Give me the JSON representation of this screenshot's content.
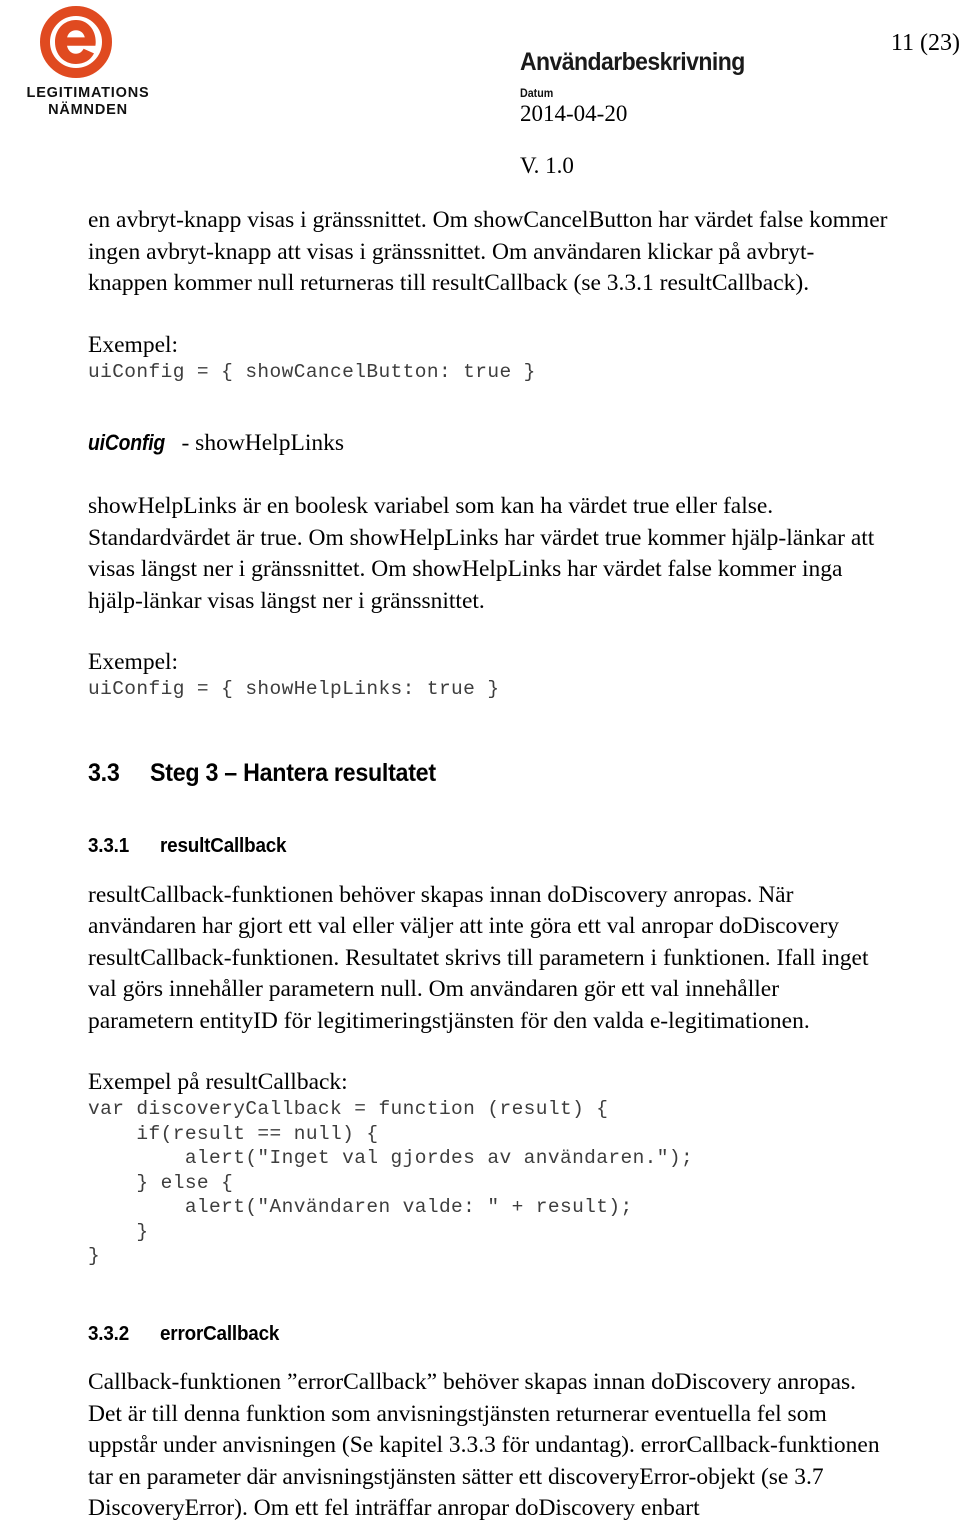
{
  "header": {
    "logo": {
      "icon": "e-circle-logo",
      "color": "#E04A20",
      "wordmark_line1": "LEGITIMATIONS",
      "wordmark_line2": "NÄMNDEN"
    },
    "document_title": "Användarbeskrivning",
    "date_label": "Datum",
    "date_value": "2014-04-20",
    "version": "V. 1.0",
    "page_number": "11 (23)"
  },
  "body": {
    "intro_paragraph": "en avbryt-knapp visas i gränssnittet. Om showCancelButton har värdet false kommer ingen avbryt-knapp att visas i gränssnittet. Om användaren klickar på avbryt-knappen kommer null returneras till resultCallback (se 3.3.1 resultCallback).",
    "exempel_label_1": "Exempel:",
    "code_1": "uiConfig = { showCancelButton: true }",
    "subsection_showhelplinks": {
      "keyword": "uiConfig",
      "rest": " - showHelpLinks"
    },
    "showhelplinks_paragraph": "showHelpLinks är en boolesk variabel som kan ha värdet true eller false. Standardvärdet är true. Om showHelpLinks har värdet true kommer hjälp-länkar att visas längst ner i gränssnittet. Om showHelpLinks har värdet false kommer inga hjälp-länkar visas längst ner i gränssnittet.",
    "exempel_label_2": "Exempel:",
    "code_2": "uiConfig = { showHelpLinks: true }",
    "heading_3_3": {
      "number": "3.3",
      "text": "Steg 3 – Hantera resultatet"
    },
    "heading_3_3_1": {
      "number": "3.3.1",
      "text": "resultCallback"
    },
    "resultcallback_paragraph": "resultCallback-funktionen behöver skapas innan doDiscovery anropas. När användaren har gjort ett val eller väljer att inte göra ett val anropar doDiscovery resultCallback-funktionen. Resultatet skrivs till parametern i funktionen. Ifall inget val görs innehåller parametern null. Om användaren gör ett val innehåller parametern entityID för legitimeringstjänsten för den valda e-legitimationen.",
    "exempel_label_3": "Exempel på resultCallback:",
    "code_3": "var discoveryCallback = function (result) {\n    if(result == null) {\n        alert(\"Inget val gjordes av användaren.\");\n    } else {\n        alert(\"Användaren valde: \" + result);\n    }\n}",
    "heading_3_3_2": {
      "number": "3.3.2",
      "text": "errorCallback"
    },
    "errorcallback_paragraph": "Callback-funktionen ”errorCallback” behöver skapas innan doDiscovery anropas. Det är till denna funktion som anvisningstjänsten returnerar eventuella fel som uppstår under anvisningen (Se kapitel 3.3.3 för undantag). errorCallback-funktionen tar en parameter där anvisningstjänsten sätter ett discoveryError-objekt (se 3.7 DiscoveryError). Om ett fel inträffar anropar doDiscovery enbart"
  }
}
